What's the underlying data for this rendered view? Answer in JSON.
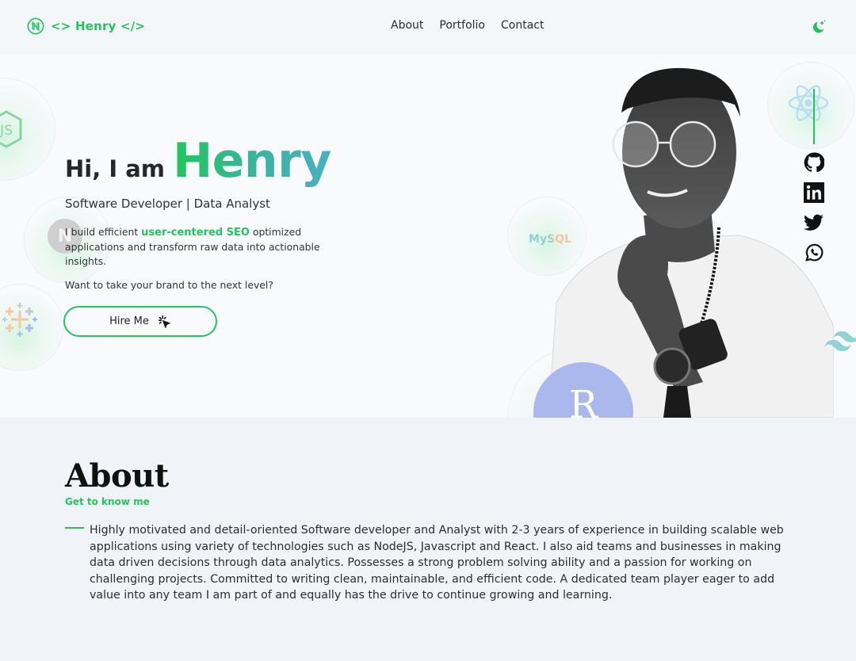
{
  "header": {
    "logo_text": "<> Henry </>",
    "nav": [
      {
        "label": "About"
      },
      {
        "label": "Portfolio"
      },
      {
        "label": "Contact"
      }
    ],
    "theme_toggle_icon": "moon-stars-icon"
  },
  "hero": {
    "greeting": "Hi, I am",
    "name": "Henry",
    "role": "Software Developer | Data Analyst",
    "intro_before": "I build efficient ",
    "intro_highlight": "user-centered SEO",
    "intro_after": " optimized applications and transform raw data into actionable insights.",
    "cta_question": "Want to take your brand to the next level?",
    "hire_button": "Hire Me",
    "hire_icon": "cursor-click-icon",
    "tech_badges": [
      "nodejs",
      "nextjs",
      "tableau",
      "mysql",
      "r",
      "react",
      "tailwind"
    ],
    "mysql_label": "MySQL",
    "r_label": "R",
    "social": [
      {
        "name": "github",
        "icon": "github-icon"
      },
      {
        "name": "linkedin",
        "icon": "linkedin-icon"
      },
      {
        "name": "twitter",
        "icon": "twitter-icon"
      },
      {
        "name": "whatsapp",
        "icon": "whatsapp-icon"
      }
    ]
  },
  "about": {
    "title": "About",
    "subtitle": "Get to know me",
    "body": "Highly motivated and detail-oriented Software developer and Analyst with 2-3 years of experience in building scalable web applications using variety of technologies such as NodeJS, Javascript and React. I also aid teams and businesses in making data driven decisions through data analytics. Possesses a strong problem solving ability and a passion for working on challenging projects. Committed to writing clean, maintainable, and efficient code. A dedicated team player eager to add value into any team I am part of and equally has the drive to continue growing and learning."
  },
  "colors": {
    "accent": "#22c55e",
    "gradient_end": "#4ab0c4",
    "header_bg": "#f3f7fa",
    "hero_bg": "#f8fafc",
    "about_bg": "#f0f4f8"
  }
}
